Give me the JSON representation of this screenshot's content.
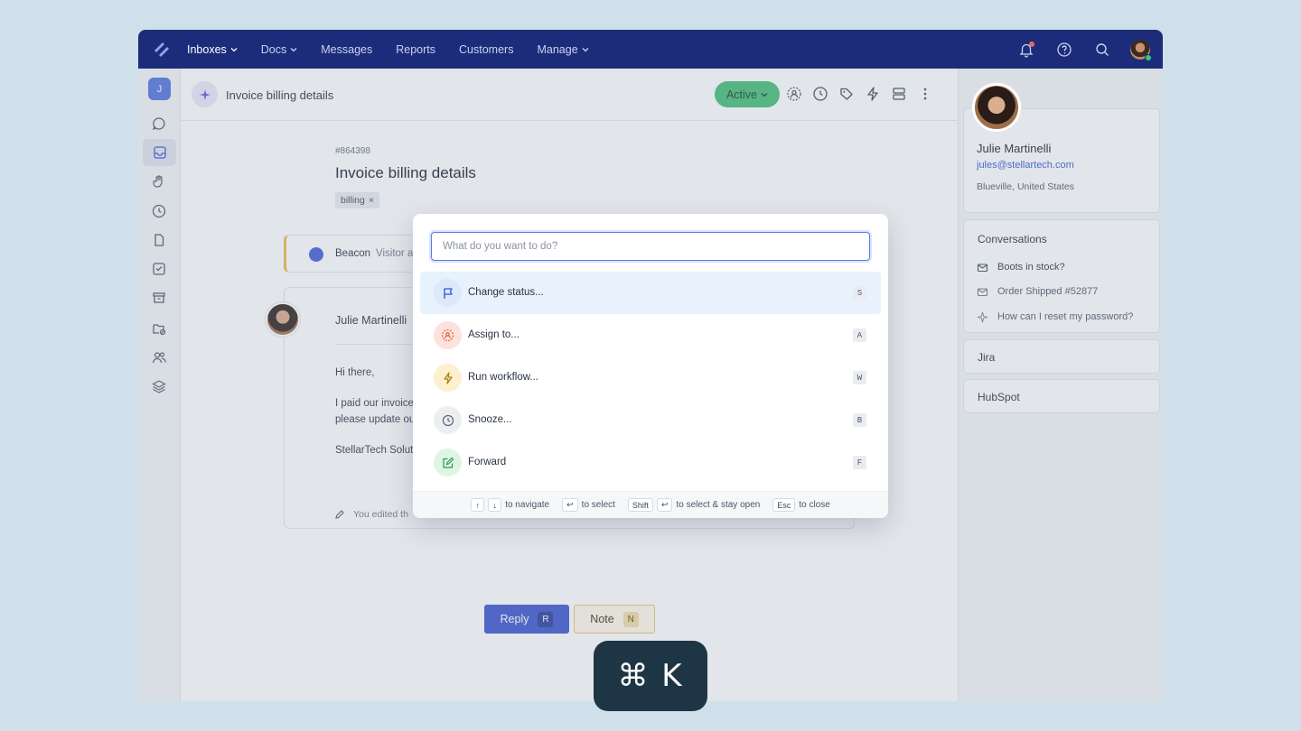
{
  "nav": {
    "items": [
      {
        "label": "Inboxes",
        "dropdown": true,
        "active": true
      },
      {
        "label": "Docs",
        "dropdown": true,
        "active": false
      },
      {
        "label": "Messages",
        "dropdown": false,
        "active": false
      },
      {
        "label": "Reports",
        "dropdown": false,
        "active": false
      },
      {
        "label": "Customers",
        "dropdown": false,
        "active": false
      },
      {
        "label": "Manage",
        "dropdown": true,
        "active": false
      }
    ]
  },
  "rail": {
    "workspace_initial": "J"
  },
  "header": {
    "title": "Invoice billing details",
    "status": "Active"
  },
  "ticket": {
    "number": "#864398",
    "title": "Invoice billing details",
    "tag": "billing",
    "tag_remove": "×"
  },
  "beacon": {
    "label": "Beacon",
    "visitor_text": "Visitor ad"
  },
  "message": {
    "author": "Julie Martinelli",
    "greeting": "Hi there,",
    "line1": "I paid our invoice",
    "line2": "please update ou",
    "signature": "StellarTech Solut",
    "edit_note": "You edited th"
  },
  "actions": {
    "reply_label": "Reply",
    "reply_key": "R",
    "note_label": "Note",
    "note_key": "N"
  },
  "customer": {
    "name": "Julie Martinelli",
    "email": "jules@stellartech.com",
    "location": "Blueville, United States"
  },
  "conversations": {
    "title": "Conversations",
    "items": [
      {
        "label": "Boots in stock?",
        "icon": "envelope-icon"
      },
      {
        "label": "Order Shipped #52877",
        "icon": "envelope-icon"
      },
      {
        "label": "How can I reset my password?",
        "icon": "sparkle-icon"
      }
    ]
  },
  "integrations": [
    "Jira",
    "HubSpot"
  ],
  "palette": {
    "placeholder": "What do you want to do?",
    "commands": [
      {
        "label": "Change status...",
        "key": "S",
        "icon": "flag-icon",
        "color": "#dbe9fb"
      },
      {
        "label": "Assign to...",
        "key": "A",
        "icon": "assign-user-icon",
        "color": "#fde1dc"
      },
      {
        "label": "Run workflow...",
        "key": "W",
        "icon": "lightning-icon",
        "color": "#fdf0cf"
      },
      {
        "label": "Snooze...",
        "key": "B",
        "icon": "clock-icon",
        "color": "#eceef1"
      },
      {
        "label": "Forward",
        "key": "F",
        "icon": "forward-edit-icon",
        "color": "#dff5e3"
      }
    ],
    "footer": {
      "navigate": "to navigate",
      "select": "to select",
      "shift_key": "Shift",
      "select_stay": "to select & stay open",
      "esc_key": "Esc",
      "close": "to close"
    }
  },
  "shortcut_badge": "⌘ K"
}
